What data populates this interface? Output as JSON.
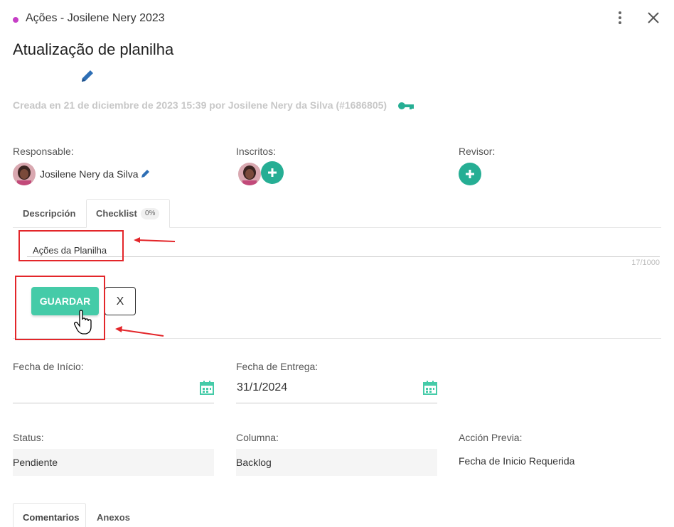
{
  "header": {
    "board_title": "Ações - Josilene Nery 2023",
    "dot_color": "#c63fc6"
  },
  "card": {
    "title": "Atualização de planilha",
    "created_text": "Creada en 21 de diciembre de 2023 15:39 por Josilene Nery da Silva (#1686805)"
  },
  "people": {
    "responsible_label": "Responsable:",
    "responsible_name": "Josilene Nery da Silva",
    "subscribers_label": "Inscritos:",
    "reviewer_label": "Revisor:"
  },
  "tabs": {
    "description": "Descripción",
    "checklist": "Checklist",
    "checklist_progress": "0%"
  },
  "checklist_form": {
    "item_value": "Ações da Planilha",
    "counter": "17/1000",
    "save_label": "GUARDAR",
    "cancel_label": "X"
  },
  "dates": {
    "start_label": "Fecha de Início:",
    "start_value": "",
    "due_label": "Fecha de Entrega:",
    "due_value": "31/1/2024"
  },
  "meta": {
    "status_label": "Status:",
    "status_value": "Pendiente",
    "column_label": "Columna:",
    "column_value": "Backlog",
    "previous_label": "Acción Previa:",
    "previous_value": "Fecha de Inicio Requerida"
  },
  "bottom_tabs": {
    "comments": "Comentarios",
    "attachments": "Anexos"
  },
  "colors": {
    "accent": "#45cba8",
    "plus": "#26ae94",
    "annotation": "#e3262a",
    "edit_icon": "#2e6fb5"
  }
}
